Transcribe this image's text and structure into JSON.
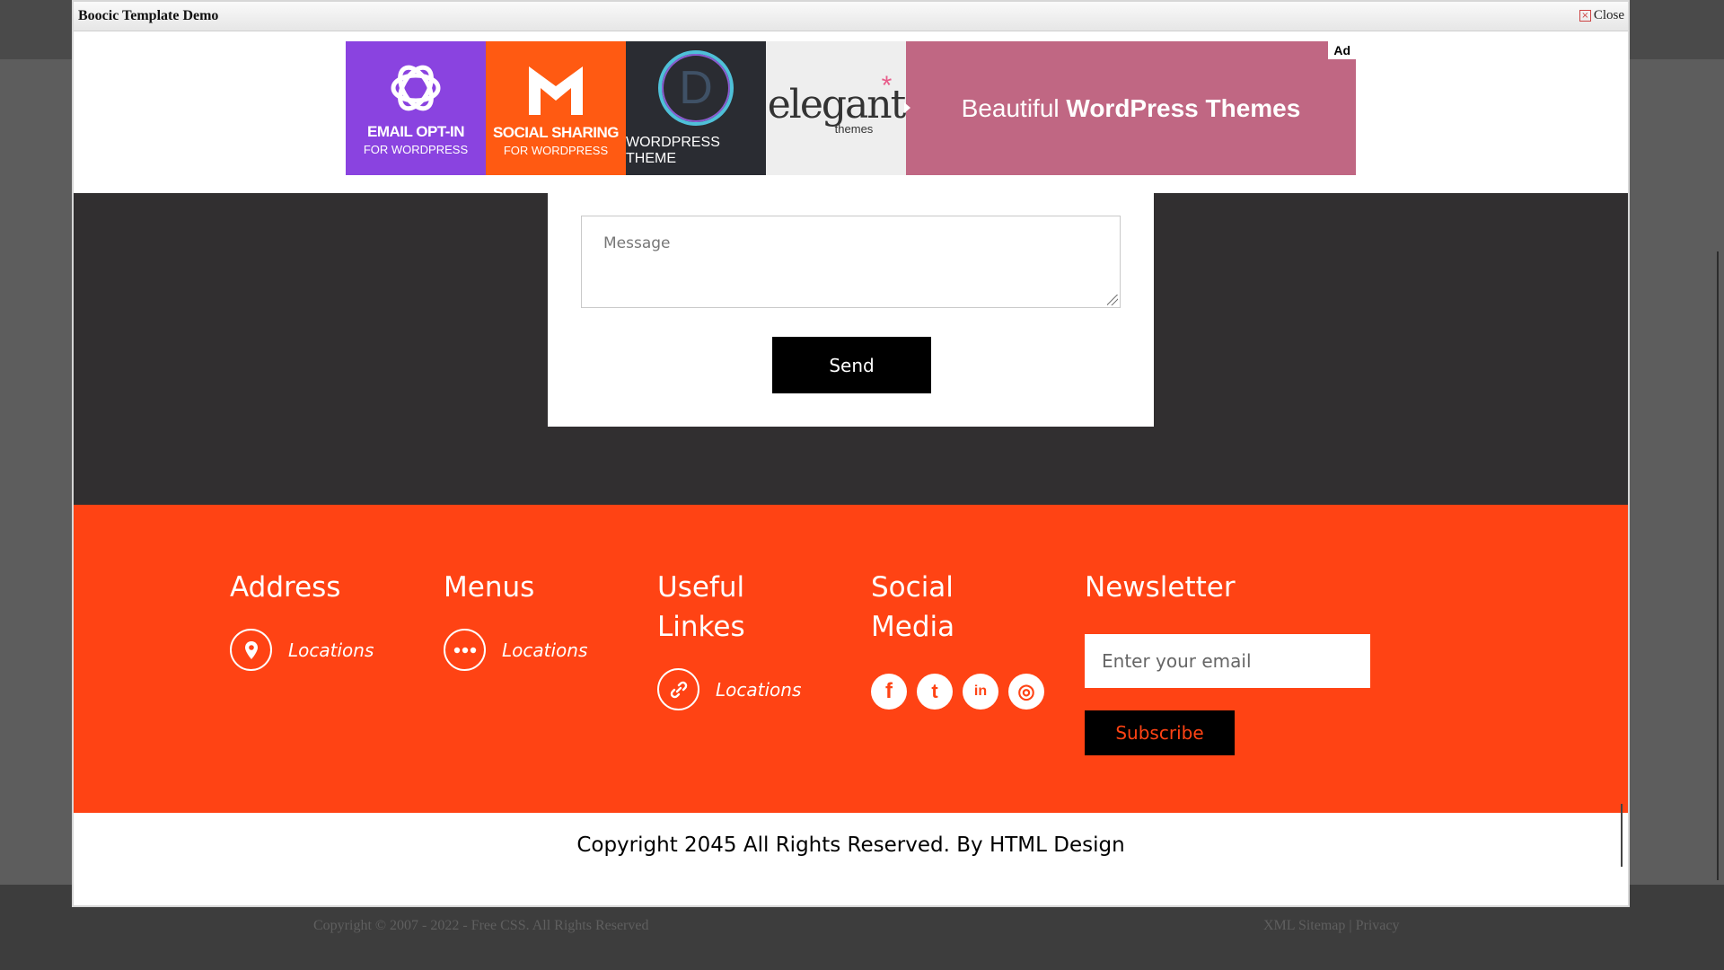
{
  "background": {
    "copyright": "Copyright © 2007 - 2022 - Free CSS. All Rights Reserved",
    "sitemap_link": "XML Sitemap",
    "separator": "|",
    "privacy_link": "Privacy"
  },
  "modal": {
    "title": "Boocic Template Demo",
    "close_label": "Close",
    "close_glyph": "×"
  },
  "ad": {
    "label": "Ad",
    "tiles": [
      {
        "line1": "EMAIL OPT-IN",
        "line2": "FOR WORDPRESS",
        "color": "#8a43e0"
      },
      {
        "line1": "SOCIAL SHARING",
        "line2": "FOR WORDPRESS",
        "color": "#ff5a12"
      },
      {
        "line1": "WORDPRESS THEME",
        "glyph": "D",
        "color": "#2a2c32"
      }
    ],
    "logo": {
      "name": "elegant",
      "sub": "themes",
      "star": "*"
    },
    "headline_pre": "Beautiful ",
    "headline_bold": "WordPress Themes",
    "headline_color": "#c06783"
  },
  "contact": {
    "message_placeholder": "Message",
    "send_label": "Send"
  },
  "footer": {
    "address": {
      "heading": "Address",
      "link": "Locations",
      "icon": "map-pin-icon"
    },
    "menus": {
      "heading": "Menus",
      "link": "Locations",
      "icon": "more-dots-icon"
    },
    "useful": {
      "heading_line1": "Useful",
      "heading_line2": "Linkes",
      "link": "Locations",
      "icon": "link-icon"
    },
    "social": {
      "heading_line1": "Social",
      "heading_line2": "Media",
      "icons": [
        {
          "name": "facebook-icon",
          "glyph": "f"
        },
        {
          "name": "twitter-icon",
          "glyph": "t"
        },
        {
          "name": "linkedin-icon",
          "glyph": "in"
        },
        {
          "name": "instagram-icon",
          "glyph": "◎"
        }
      ]
    },
    "newsletter": {
      "heading": "Newsletter",
      "email_placeholder": "Enter your email",
      "subscribe_label": "Subscribe"
    },
    "accent": "#ff4314"
  },
  "copyright": {
    "text": "Copyright 2045 All Rights Reserved. By ",
    "link": "HTML Design"
  }
}
